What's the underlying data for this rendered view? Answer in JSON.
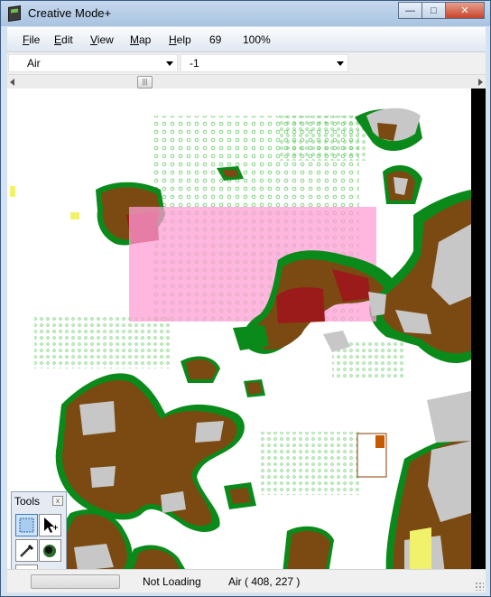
{
  "window": {
    "title": "Creative Mode+"
  },
  "window_buttons": {
    "minimize": "—",
    "maximize": "□",
    "close": "✕"
  },
  "menubar": {
    "items": [
      {
        "label": "File",
        "underline": "F",
        "rest": "ile"
      },
      {
        "label": "Edit",
        "underline": "E",
        "rest": "dit"
      },
      {
        "label": "View",
        "underline": "V",
        "rest": "iew"
      },
      {
        "label": "Map",
        "underline": "M",
        "rest": "ap"
      },
      {
        "label": "Help",
        "underline": "H",
        "rest": "elp"
      }
    ],
    "level": "69",
    "zoom": "100%"
  },
  "selectors": {
    "block": {
      "value": "Air"
    },
    "data": {
      "value": "-1"
    }
  },
  "scroll": {
    "thumb_glyph": "|||"
  },
  "map": {
    "colors": {
      "background": "#ffffff",
      "dirt": "#7a4a12",
      "grass": "#0a8a1a",
      "stone": "#c7c7c7",
      "gravel": "#8c8c8c",
      "sand": "#f2f26a",
      "foliage": "#6acb6a",
      "redstone": "#9b1a1a",
      "selection": "#ff9fd6",
      "void": "#000000",
      "chest": "#c65a00"
    }
  },
  "tools": {
    "title": "Tools",
    "close_glyph": "x",
    "items": [
      {
        "name": "select-tool",
        "icon": "dotted-rect-icon",
        "active": true
      },
      {
        "name": "move-tool",
        "icon": "arrow-move-icon",
        "active": false
      },
      {
        "name": "picker-tool",
        "icon": "eyedropper-icon",
        "active": false
      },
      {
        "name": "fill-tool",
        "icon": "paint-bucket-icon",
        "active": false
      },
      {
        "name": "pencil-tool",
        "icon": "pencil-icon",
        "active": false
      }
    ]
  },
  "status": {
    "loading": "Not Loading",
    "block_info": "Air ( 408, 227 )"
  }
}
